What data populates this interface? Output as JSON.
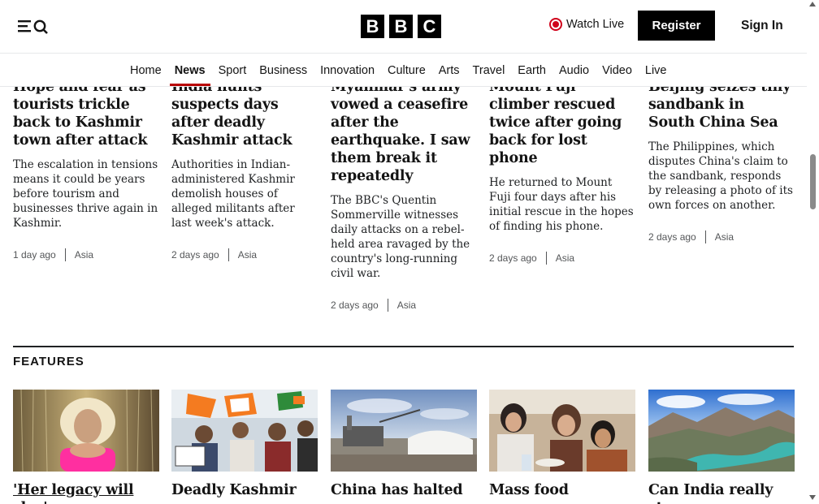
{
  "header": {
    "logo_letters": [
      "B",
      "B",
      "C"
    ],
    "menu_icon": "menu-search-icon",
    "watch_live_label": "Watch Live",
    "register_label": "Register",
    "signin_label": "Sign In",
    "live_color": "#d0021b"
  },
  "nav": {
    "items": [
      "Home",
      "News",
      "Sport",
      "Business",
      "Innovation",
      "Culture",
      "Arts",
      "Travel",
      "Earth",
      "Audio",
      "Video",
      "Live"
    ],
    "active": "News",
    "accent": "#b80000"
  },
  "top_stories": [
    {
      "headline_top": "Hope and fear as",
      "headline": "tourists trickle back to Kashmir town after attack",
      "summary": "The escalation in tensions means it could be years before tourism and businesses thrive again in Kashmir.",
      "time": "1 day ago",
      "section": "Asia"
    },
    {
      "headline_top": "India hunts suspects",
      "headline": "days after deadly Kashmir attack",
      "summary": "Authorities in Indian-administered Kashmir demolish houses of alleged militants after last week's attack.",
      "time": "2 days ago",
      "section": "Asia"
    },
    {
      "headline_top": "Myanmar's army",
      "headline": "vowed a ceasefire after the earthquake. I saw them break it repeatedly",
      "summary": "The BBC's Quentin Sommerville witnesses daily attacks on a rebel-held area ravaged by the country's long-running civil war.",
      "time": "2 days ago",
      "section": "Asia"
    },
    {
      "headline_top": "Mount Fuji climber",
      "headline": "rescued twice after going back for lost phone",
      "summary": "He returned to Mount Fuji four days after his initial rescue in the hopes of finding his phone.",
      "time": "2 days ago",
      "section": "Asia"
    },
    {
      "headline_top": "Beijing seizes tiny",
      "headline": "sandbank in South China Sea",
      "summary": "The Philippines, which disputes China's claim to the sandbank, responds by releasing a photo of its own forces on another.",
      "time": "2 days ago",
      "section": "Asia"
    }
  ],
  "features": {
    "title": "FEATURES",
    "items": [
      {
        "headline": "'Her legacy will slay':",
        "image": "drag-performer-photo"
      },
      {
        "headline": "Deadly Kashmir",
        "image": "protest-flags-photo"
      },
      {
        "headline": "China has halted",
        "image": "industrial-plant-photo"
      },
      {
        "headline": "Mass food",
        "image": "students-eating-photo"
      },
      {
        "headline": "Can India really stop",
        "image": "river-valley-photo"
      }
    ]
  }
}
